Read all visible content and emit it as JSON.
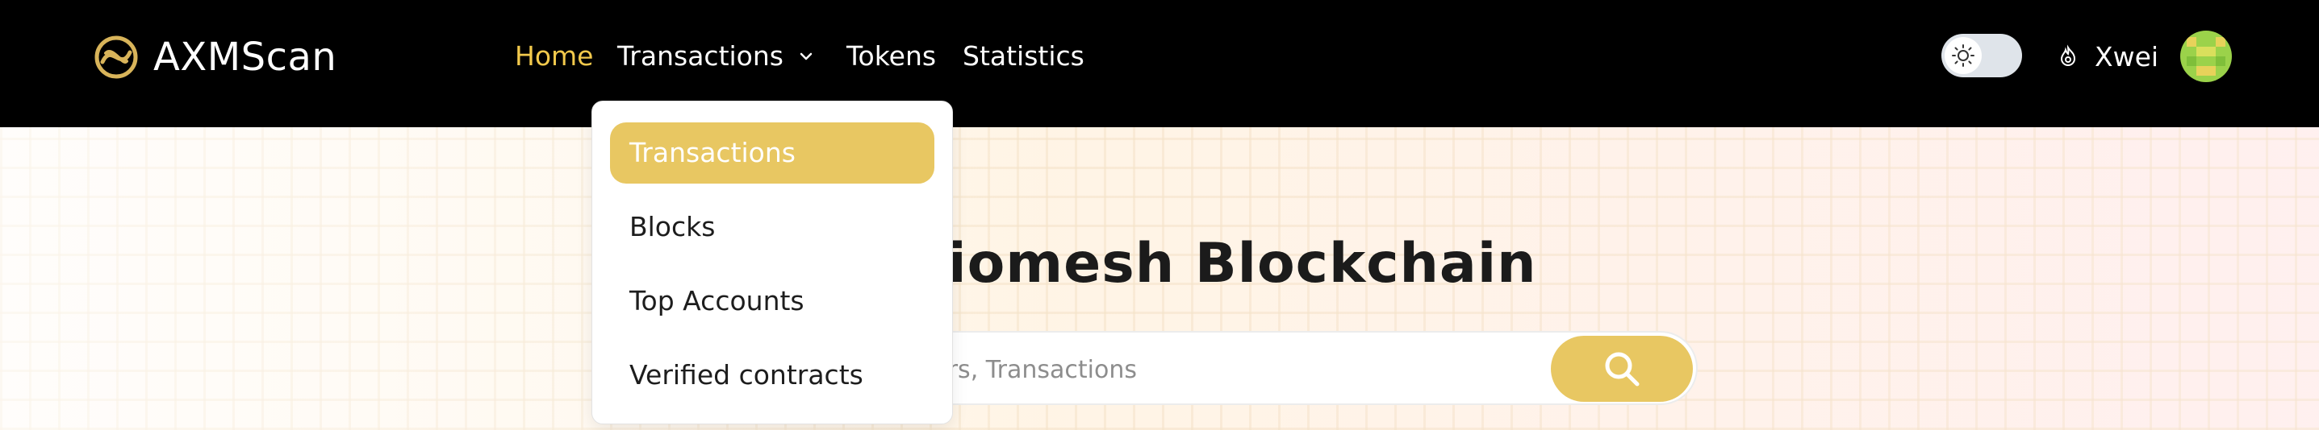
{
  "brand": {
    "name": "AXMScan",
    "logo_icon": "axm-logo-icon"
  },
  "nav": {
    "items": [
      {
        "label": "Home"
      },
      {
        "label": "Transactions"
      },
      {
        "label": "Tokens"
      },
      {
        "label": "Statistics"
      }
    ],
    "active_color": "#f2c94c"
  },
  "header": {
    "theme_toggle_icon": "sun-icon",
    "user": {
      "name": "Xwei",
      "icon": "fire-icon"
    }
  },
  "dropdown": {
    "items": [
      {
        "label": "Transactions"
      },
      {
        "label": "Blocks"
      },
      {
        "label": "Top Accounts"
      },
      {
        "label": "Verified contracts"
      }
    ],
    "highlight_color": "#e8c762"
  },
  "hero": {
    "title": "re Axiomesh Blockchain",
    "search_placeholder": "mbers, Transactions",
    "search_icon": "search-icon"
  }
}
